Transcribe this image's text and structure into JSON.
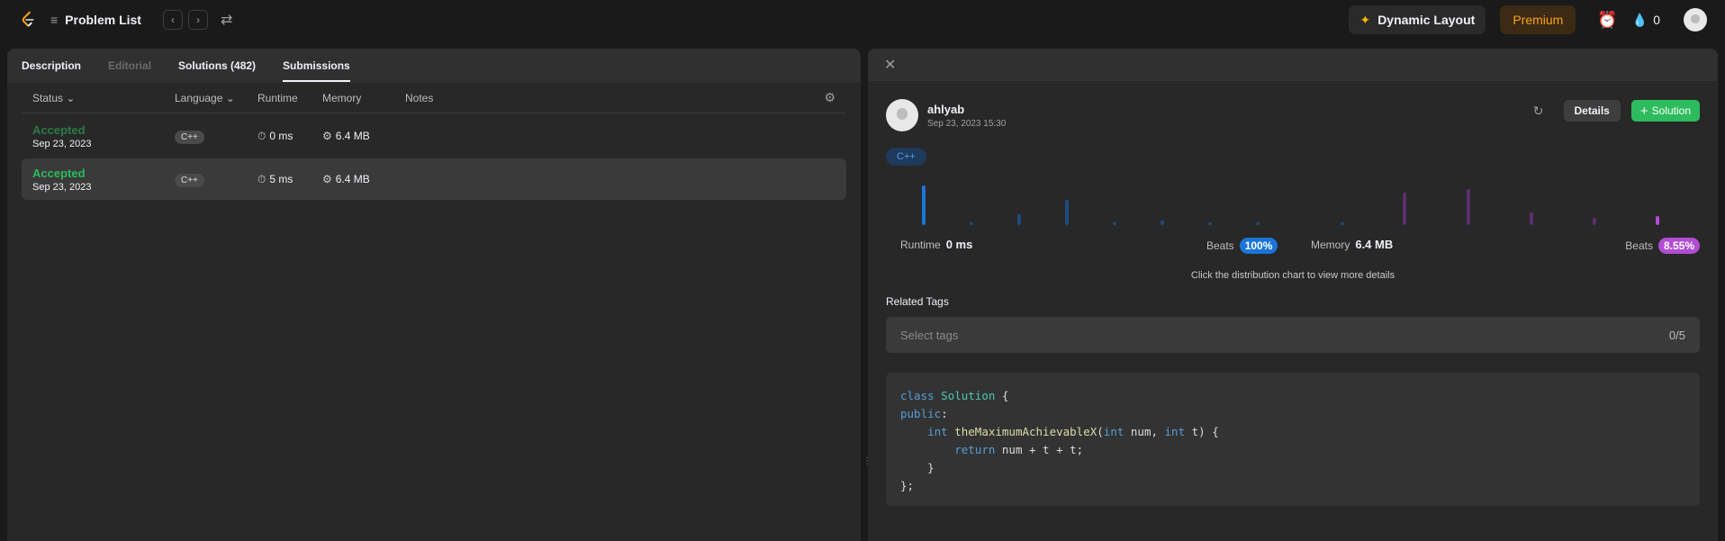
{
  "topbar": {
    "problem_list_label": "Problem List",
    "dynamic_layout_label": "Dynamic Layout",
    "premium_label": "Premium",
    "streak_count": "0"
  },
  "left_panel": {
    "tabs": [
      {
        "label": "Description"
      },
      {
        "label": "Editorial"
      },
      {
        "label": "Solutions (482)"
      },
      {
        "label": "Submissions"
      }
    ],
    "columns": {
      "status": "Status",
      "language": "Language",
      "runtime": "Runtime",
      "memory": "Memory",
      "notes": "Notes"
    },
    "rows": [
      {
        "status": "Accepted",
        "date": "Sep 23, 2023",
        "language": "C++",
        "runtime": "0 ms",
        "memory": "6.4 MB"
      },
      {
        "status": "Accepted",
        "date": "Sep 23, 2023",
        "language": "C++",
        "runtime": "5 ms",
        "memory": "6.4 MB"
      }
    ]
  },
  "right_panel": {
    "user": {
      "name": "ahlyab",
      "datetime": "Sep 23, 2023 15:30"
    },
    "details_label": "Details",
    "solution_label": "Solution",
    "language_tag": "C++",
    "runtime_label": "Runtime",
    "runtime_value": "0 ms",
    "beats_label": "Beats",
    "runtime_beats": "100%",
    "memory_label": "Memory",
    "memory_value": "6.4 MB",
    "memory_beats": "8.55%",
    "hint": "Click the distribution chart to view more details",
    "related_tags_label": "Related Tags",
    "tags_placeholder": "Select tags",
    "tags_count": "0/5",
    "code_lines": [
      "class Solution {",
      "public:",
      "    int theMaximumAchievableX(int num, int t) {",
      "        return num + t + t;",
      "    }",
      "};"
    ]
  },
  "colors": {
    "accepted": "#2cbb5d",
    "premium": "#ffa116",
    "runtime_beats": "#1a75d6",
    "memory_beats": "#b14cd3"
  }
}
